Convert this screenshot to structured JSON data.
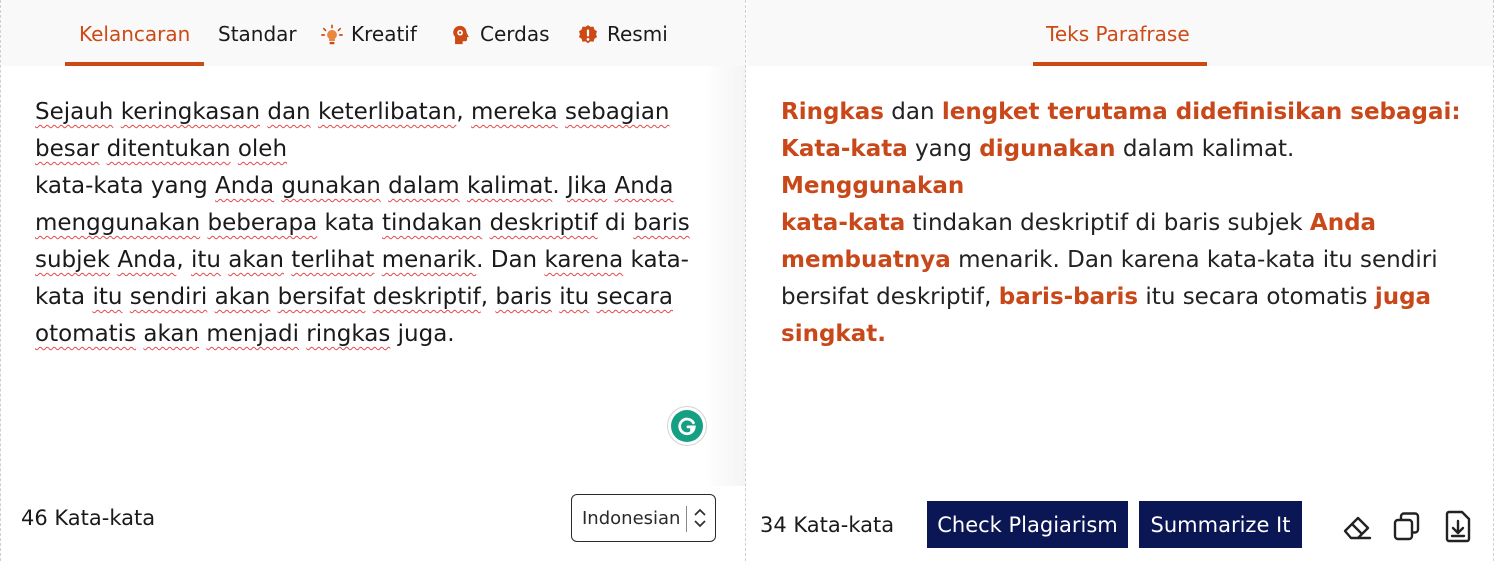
{
  "left_pane": {
    "tabs": [
      {
        "label": "Kelancaran",
        "icon": ""
      },
      {
        "label": "Standar",
        "icon": ""
      },
      {
        "label": "Kreatif",
        "icon": "lightbulb-icon"
      },
      {
        "label": "Cerdas",
        "icon": "brain-head-icon"
      },
      {
        "label": "Resmi",
        "icon": "info-badge-icon"
      }
    ],
    "active_tab": "Kelancaran",
    "input_text": {
      "s1": "Sejauh",
      "s2": " ",
      "s3": "keringkasan",
      "s4": " ",
      "s5": "dan",
      "s6": " ",
      "s7": "keterlibatan",
      "s8": ", ",
      "s9": "mereka",
      "s10": " ",
      "s11": "sebagian",
      "s12": "besar",
      "s13": " ",
      "s14": "ditentukan",
      "s15": " ",
      "s16": "oleh",
      "s17": "kata-kata yang ",
      "s18": "Anda",
      "s19": " ",
      "s20": "gunakan",
      "s21": " ",
      "s22": "dalam",
      "s23": " ",
      "s24": "kalimat",
      "s25": ". ",
      "s26": "Jika",
      "s27": " ",
      "s28": "Anda",
      "s29": "menggunakan",
      "s30": " ",
      "s31": "beberapa",
      "s32": " kata ",
      "s33": "tindakan",
      "s34": " ",
      "s35": "deskriptif",
      "s36": " di ",
      "s37": "baris",
      "s38": "subjek",
      "s39": " ",
      "s40": "Anda",
      "s41": ", ",
      "s42": "itu",
      "s43": " ",
      "s44": "akan",
      "s45": " ",
      "s46": "terlihat",
      "s47": " ",
      "s48": "menarik",
      "s49": ". Dan ",
      "s50": "karena",
      "s51": " kata-",
      "s52": "kata ",
      "s53": "itu",
      "s54": " ",
      "s55": "sendiri",
      "s56": " ",
      "s57": "akan",
      "s58": " ",
      "s59": "bersifat",
      "s60": " ",
      "s61": "deskriptif",
      "s62": ", ",
      "s63": "baris",
      "s64": " ",
      "s65": "itu",
      "s66": " ",
      "s67": "secara",
      "s68": "otomatis",
      "s69": " ",
      "s70": "akan",
      "s71": " ",
      "s72": "menjadi",
      "s73": " ",
      "s74": "ringkas",
      "s75": " juga."
    },
    "word_count": "46 Kata-kata",
    "language_select": {
      "value": "Indonesian"
    }
  },
  "right_pane": {
    "tab": {
      "label": "Teks Parafrase"
    },
    "output_text": {
      "o1": "Ringkas",
      "o2": " dan ",
      "o3": "lengket terutama didefinisikan sebagai:",
      "o4": "Kata-kata",
      "o5": " yang ",
      "o6": "digunakan",
      "o7": " dalam kalimat. ",
      "o8": "Menggunakan",
      "o9": "kata-kata",
      "o10": " tindakan deskriptif di baris subjek ",
      "o11": "Anda",
      "o12": "membuatnya",
      "o13": " menarik. Dan karena kata-kata itu sendiri",
      "o14": "bersifat deskriptif, ",
      "o15": "baris-baris",
      "o16": " itu secara otomatis ",
      "o17": "juga",
      "o18": "singkat."
    },
    "word_count": "34 Kata-kata",
    "buttons": {
      "check_plagiarism": "Check Plagiarism",
      "summarize": "Summarize It"
    },
    "tools": [
      "eraser-icon",
      "copy-icon",
      "download-icon"
    ]
  },
  "colors": {
    "accent": "#cc4a15",
    "button_bg": "#0b1754",
    "grammarly": "#15a083",
    "spell_underline": "#e24a4a"
  }
}
